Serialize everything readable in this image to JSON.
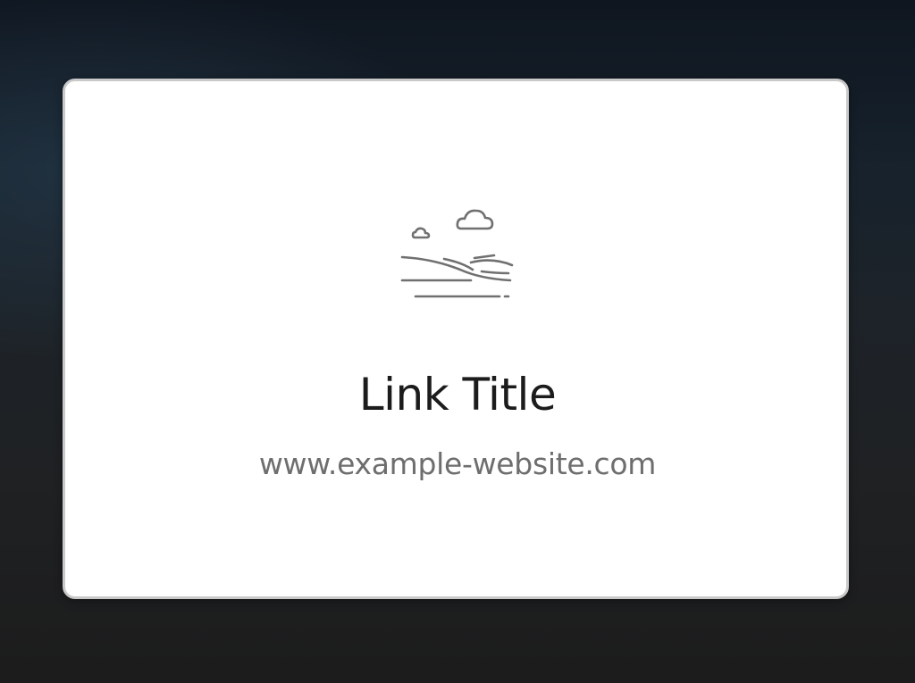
{
  "link_card": {
    "icon": "landscape-placeholder-icon",
    "title": "Link Title",
    "url": "www.example-website.com"
  },
  "colors": {
    "card_background": "#ffffff",
    "card_border": "#c9c9c9",
    "title_text": "#1c1c1c",
    "url_text": "#6e6e6e",
    "icon_stroke": "#707070"
  }
}
